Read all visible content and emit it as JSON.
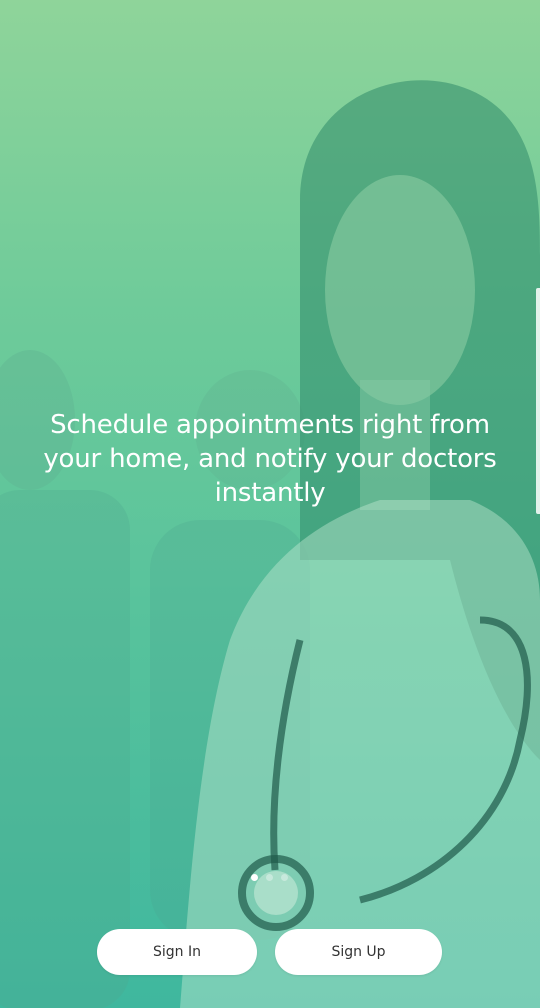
{
  "onboarding": {
    "headline": "Schedule appointments right from your home, and notify your doctors instantly",
    "page_indicator": {
      "total": 3,
      "active": 1
    }
  },
  "actions": {
    "sign_in_label": "Sign In",
    "sign_up_label": "Sign Up"
  },
  "colors": {
    "overlay_top": "#8fd49a",
    "overlay_bottom": "#3fb79e",
    "button_bg": "#ffffff",
    "button_text": "#333333"
  },
  "background_image": "doctor-with-stethoscope-photo"
}
